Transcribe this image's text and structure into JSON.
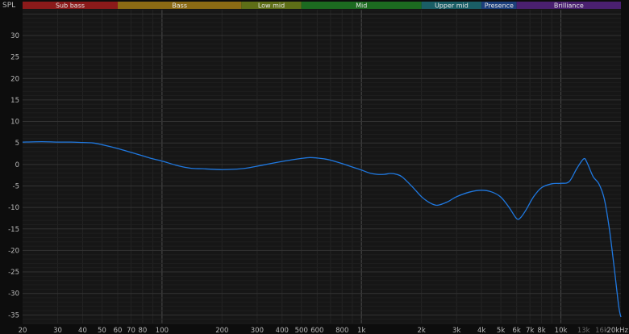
{
  "chart_data": {
    "type": "line",
    "ylabel": "SPL",
    "xscale": "log",
    "xlim": [
      20,
      20000
    ],
    "ylim": [
      -37,
      36
    ],
    "grid": true,
    "x_ticks": [
      {
        "value": 20,
        "label": "20"
      },
      {
        "value": 30,
        "label": "30"
      },
      {
        "value": 40,
        "label": "40"
      },
      {
        "value": 50,
        "label": "50"
      },
      {
        "value": 60,
        "label": "60"
      },
      {
        "value": 70,
        "label": "70"
      },
      {
        "value": 80,
        "label": "80"
      },
      {
        "value": 100,
        "label": "100"
      },
      {
        "value": 200,
        "label": "200"
      },
      {
        "value": 300,
        "label": "300"
      },
      {
        "value": 400,
        "label": "400"
      },
      {
        "value": 500,
        "label": "500"
      },
      {
        "value": 600,
        "label": "600"
      },
      {
        "value": 800,
        "label": "800"
      },
      {
        "value": 1000,
        "label": "1k"
      },
      {
        "value": 2000,
        "label": "2k"
      },
      {
        "value": 3000,
        "label": "3k"
      },
      {
        "value": 4000,
        "label": "4k"
      },
      {
        "value": 5000,
        "label": "5k"
      },
      {
        "value": 6000,
        "label": "6k"
      },
      {
        "value": 7000,
        "label": "7k"
      },
      {
        "value": 8000,
        "label": "8k"
      },
      {
        "value": 10000,
        "label": "10k"
      },
      {
        "value": 13000,
        "label": "13k"
      },
      {
        "value": 16000,
        "label": "16k"
      },
      {
        "value": 20000,
        "label": "20kHz"
      }
    ],
    "y_ticks": [
      30,
      25,
      20,
      15,
      10,
      5,
      0,
      -5,
      -10,
      -15,
      -20,
      -25,
      -30,
      -35
    ],
    "bands": [
      {
        "label": "Sub bass",
        "from": 20,
        "to": 60,
        "color": "#8b1a1a"
      },
      {
        "label": "Bass",
        "from": 60,
        "to": 250,
        "color": "#8b6a14"
      },
      {
        "label": "Low mid",
        "from": 250,
        "to": 500,
        "color": "#5e6e17"
      },
      {
        "label": "Mid",
        "from": 500,
        "to": 2000,
        "color": "#1c6a20"
      },
      {
        "label": "Upper mid",
        "from": 2000,
        "to": 4000,
        "color": "#1a5e66"
      },
      {
        "label": "Presence",
        "from": 4000,
        "to": 6000,
        "color": "#1c3f7c"
      },
      {
        "label": "Brilliance",
        "from": 6000,
        "to": 20000,
        "color": "#4a2070"
      }
    ],
    "series": [
      {
        "color": "#1f78e0",
        "points": [
          [
            20,
            5.2
          ],
          [
            25,
            5.3
          ],
          [
            30,
            5.2
          ],
          [
            35,
            5.2
          ],
          [
            40,
            5.1
          ],
          [
            45,
            5.0
          ],
          [
            50,
            4.6
          ],
          [
            60,
            3.7
          ],
          [
            70,
            2.8
          ],
          [
            80,
            2.0
          ],
          [
            90,
            1.3
          ],
          [
            100,
            0.8
          ],
          [
            120,
            -0.3
          ],
          [
            140,
            -0.9
          ],
          [
            160,
            -1.0
          ],
          [
            200,
            -1.2
          ],
          [
            250,
            -1.0
          ],
          [
            300,
            -0.4
          ],
          [
            350,
            0.2
          ],
          [
            400,
            0.7
          ],
          [
            450,
            1.1
          ],
          [
            500,
            1.4
          ],
          [
            550,
            1.6
          ],
          [
            600,
            1.5
          ],
          [
            650,
            1.3
          ],
          [
            700,
            1.0
          ],
          [
            800,
            0.2
          ],
          [
            900,
            -0.6
          ],
          [
            1000,
            -1.3
          ],
          [
            1100,
            -2.0
          ],
          [
            1200,
            -2.3
          ],
          [
            1300,
            -2.3
          ],
          [
            1400,
            -2.1
          ],
          [
            1500,
            -2.3
          ],
          [
            1600,
            -2.9
          ],
          [
            1800,
            -5.2
          ],
          [
            2000,
            -7.5
          ],
          [
            2200,
            -8.9
          ],
          [
            2400,
            -9.5
          ],
          [
            2700,
            -8.7
          ],
          [
            3000,
            -7.5
          ],
          [
            3500,
            -6.4
          ],
          [
            4000,
            -6.0
          ],
          [
            4500,
            -6.4
          ],
          [
            5000,
            -7.6
          ],
          [
            5500,
            -10.0
          ],
          [
            6000,
            -12.6
          ],
          [
            6300,
            -12.3
          ],
          [
            6700,
            -10.5
          ],
          [
            7300,
            -7.5
          ],
          [
            8000,
            -5.4
          ],
          [
            9000,
            -4.5
          ],
          [
            10000,
            -4.4
          ],
          [
            11000,
            -4.0
          ],
          [
            12000,
            -1.0
          ],
          [
            13000,
            1.3
          ],
          [
            13500,
            0.5
          ],
          [
            14500,
            -2.8
          ],
          [
            15500,
            -4.5
          ],
          [
            16500,
            -8.0
          ],
          [
            17500,
            -15.0
          ],
          [
            18500,
            -24.0
          ],
          [
            19500,
            -33.0
          ],
          [
            20000,
            -35.5
          ]
        ]
      }
    ]
  }
}
